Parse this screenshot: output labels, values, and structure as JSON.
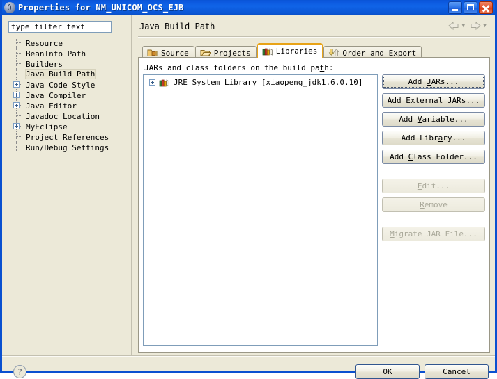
{
  "window": {
    "title": "Properties for NM_UNICOM_OCS_EJB",
    "icon": "eclipse-properties-icon",
    "controls": {
      "minimize": "Minimize",
      "maximize": "Maximize",
      "close": "Close"
    }
  },
  "sidebar": {
    "filter": {
      "value": "type filter text",
      "placeholder": "type filter text"
    },
    "items": [
      {
        "label": "Resource",
        "expandable": false,
        "selected": false
      },
      {
        "label": "BeanInfo Path",
        "expandable": false,
        "selected": false
      },
      {
        "label": "Builders",
        "expandable": false,
        "selected": false
      },
      {
        "label": "Java Build Path",
        "expandable": false,
        "selected": true
      },
      {
        "label": "Java Code Style",
        "expandable": true,
        "selected": false
      },
      {
        "label": "Java Compiler",
        "expandable": true,
        "selected": false
      },
      {
        "label": "Java Editor",
        "expandable": true,
        "selected": false
      },
      {
        "label": "Javadoc Location",
        "expandable": false,
        "selected": false
      },
      {
        "label": "MyEclipse",
        "expandable": true,
        "selected": false
      },
      {
        "label": "Project References",
        "expandable": false,
        "selected": false
      },
      {
        "label": "Run/Debug Settings",
        "expandable": false,
        "selected": false
      }
    ]
  },
  "main": {
    "page_title": "Java Build Path",
    "nav": {
      "back_icon": "back-arrow-icon",
      "forward_icon": "forward-arrow-icon",
      "dropdown_icon": "chevron-down-icon"
    },
    "tabs": [
      {
        "label": "Source",
        "icon": "source-folder-icon",
        "active": false
      },
      {
        "label": "Projects",
        "icon": "open-folder-icon",
        "active": false
      },
      {
        "label": "Libraries",
        "icon": "books-icon",
        "active": true
      },
      {
        "label": "Order and Export",
        "icon": "order-arrows-icon",
        "active": false
      }
    ],
    "list_label_pre": "JARs and class folders on the build pa",
    "list_label_mnemonic": "t",
    "list_label_post": "h:",
    "entries": [
      {
        "label": "JRE System Library [xiaopeng_jdk1.6.0.10]",
        "icon": "books-icon",
        "expandable": true
      }
    ],
    "side_buttons": [
      {
        "pre": "Add ",
        "mnemonic": "J",
        "post": "ARs...",
        "disabled": false,
        "focused": true,
        "gap": false
      },
      {
        "pre": "Add E",
        "mnemonic": "x",
        "post": "ternal JARs...",
        "disabled": false,
        "focused": false,
        "gap": false
      },
      {
        "pre": "Add ",
        "mnemonic": "V",
        "post": "ariable...",
        "disabled": false,
        "focused": false,
        "gap": false
      },
      {
        "pre": "Add Libr",
        "mnemonic": "a",
        "post": "ry...",
        "disabled": false,
        "focused": false,
        "gap": false
      },
      {
        "pre": "Add ",
        "mnemonic": "C",
        "post": "lass Folder...",
        "disabled": false,
        "focused": false,
        "gap": false
      },
      {
        "pre": "",
        "mnemonic": "E",
        "post": "dit...",
        "disabled": true,
        "focused": false,
        "gap": true
      },
      {
        "pre": "",
        "mnemonic": "R",
        "post": "emove",
        "disabled": true,
        "focused": false,
        "gap": false
      },
      {
        "pre": "",
        "mnemonic": "M",
        "post": "igrate JAR File...",
        "disabled": true,
        "focused": false,
        "gap": true
      }
    ]
  },
  "footer": {
    "help_glyph": "?",
    "ok_label": "OK",
    "cancel_label": "Cancel"
  }
}
